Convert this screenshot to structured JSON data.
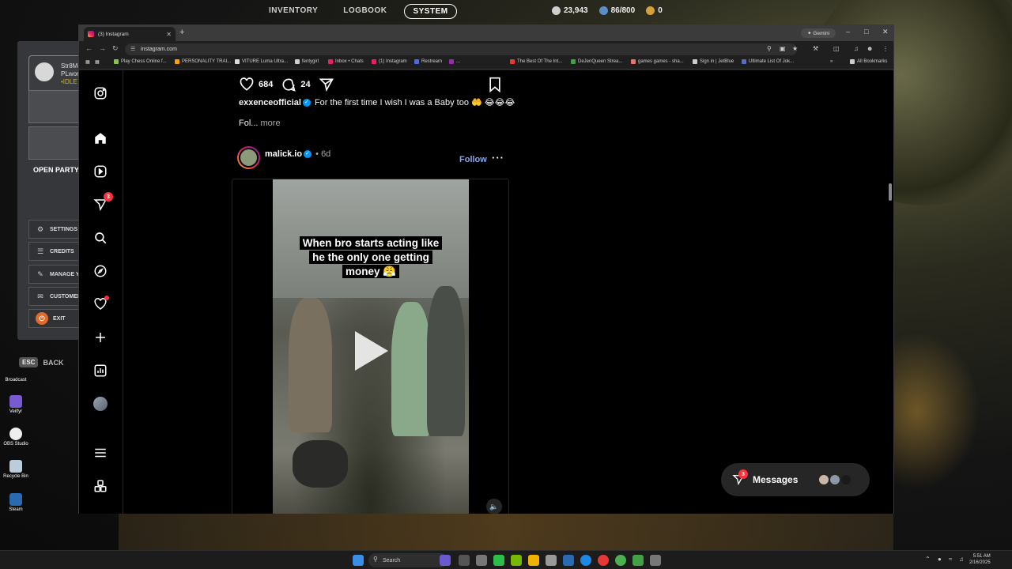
{
  "game": {
    "nav": [
      "INVENTORY",
      "LOGBOOK",
      "SYSTEM"
    ],
    "nav_active": "SYSTEM",
    "stats": [
      {
        "icon": "currency-icon",
        "value": "23,943",
        "color": "#d0d0d0"
      },
      {
        "icon": "level-icon",
        "value": "86/800",
        "color": "#5a8ec8"
      },
      {
        "icon": "gold-icon",
        "value": "0",
        "color": "#d4a23a"
      }
    ],
    "profile": {
      "name": "Str8Me",
      "line2": "PLwor",
      "line3": "•IDLE"
    },
    "open_party": "OPEN PARTY",
    "menu": [
      {
        "label": "SETTINGS",
        "icon": "gear-icon"
      },
      {
        "label": "CREDITS",
        "icon": "list-icon"
      },
      {
        "label": "MANAGE Y",
        "icon": "edit-icon"
      },
      {
        "label": "CUSTOMER",
        "icon": "support-icon"
      },
      {
        "label": "EXIT",
        "icon": "power-icon"
      }
    ],
    "back_key": "ESC",
    "back_label": "BACK"
  },
  "desktop": {
    "icons": [
      {
        "label": "Broadcast",
        "color": "#444"
      },
      {
        "label": "Veilfyr",
        "color": "#7a5ad0"
      },
      {
        "label": "OBS Studio",
        "color": "#eee"
      },
      {
        "label": "Recycle Bin",
        "color": "#bcd"
      },
      {
        "label": "Steam",
        "color": "#2a6ab0"
      }
    ]
  },
  "browser": {
    "tab_title": "(3) Instagram",
    "url": "instagram.com",
    "gemini": "Gemini",
    "bookmarks": [
      {
        "label": "Play Chess Online f...",
        "color": "#8bc34a"
      },
      {
        "label": "PERSONALITY TRAI...",
        "color": "#ffa000"
      },
      {
        "label": "VITURE Luma Ultra...",
        "color": "#ddd"
      },
      {
        "label": "fentygirl",
        "color": "#ccc"
      },
      {
        "label": "Inbox • Chats",
        "color": "#e91e63"
      },
      {
        "label": "(1) Instagram",
        "color": "#e91e63"
      },
      {
        "label": "Restream",
        "color": "#4a6ae8"
      },
      {
        "label": "...",
        "color": "#9c27b0"
      },
      {
        "label": "The Best Of The Int...",
        "color": "#e53935"
      },
      {
        "label": "DeJenQueen Strea...",
        "color": "#43a047"
      },
      {
        "label": "games games - sha...",
        "color": "#e57373"
      },
      {
        "label": "Sign in | JetBlue",
        "color": "#ccc"
      },
      {
        "label": "Ultimate List Of Jok...",
        "color": "#5c6bc0"
      }
    ],
    "all_bookmarks": "All Bookmarks"
  },
  "instagram": {
    "notifications_count": "3",
    "post1": {
      "likes": "684",
      "comments": "24",
      "username": "exxenceofficial",
      "caption": "For the first time I wish I was a Baby too",
      "caption_emoji": "🤲 😂😂😂",
      "truncated": "Fol...",
      "more": "more"
    },
    "post2": {
      "username": "malick.io",
      "separator": "•",
      "time": "6d",
      "follow": "Follow",
      "overlay_lines": [
        "When bro starts acting like",
        "he the only one getting",
        "money 😤"
      ]
    },
    "messages": {
      "label": "Messages",
      "badge": "3"
    }
  },
  "taskbar": {
    "search": "Search",
    "time": "5:51 AM",
    "date": "2/16/2025"
  }
}
